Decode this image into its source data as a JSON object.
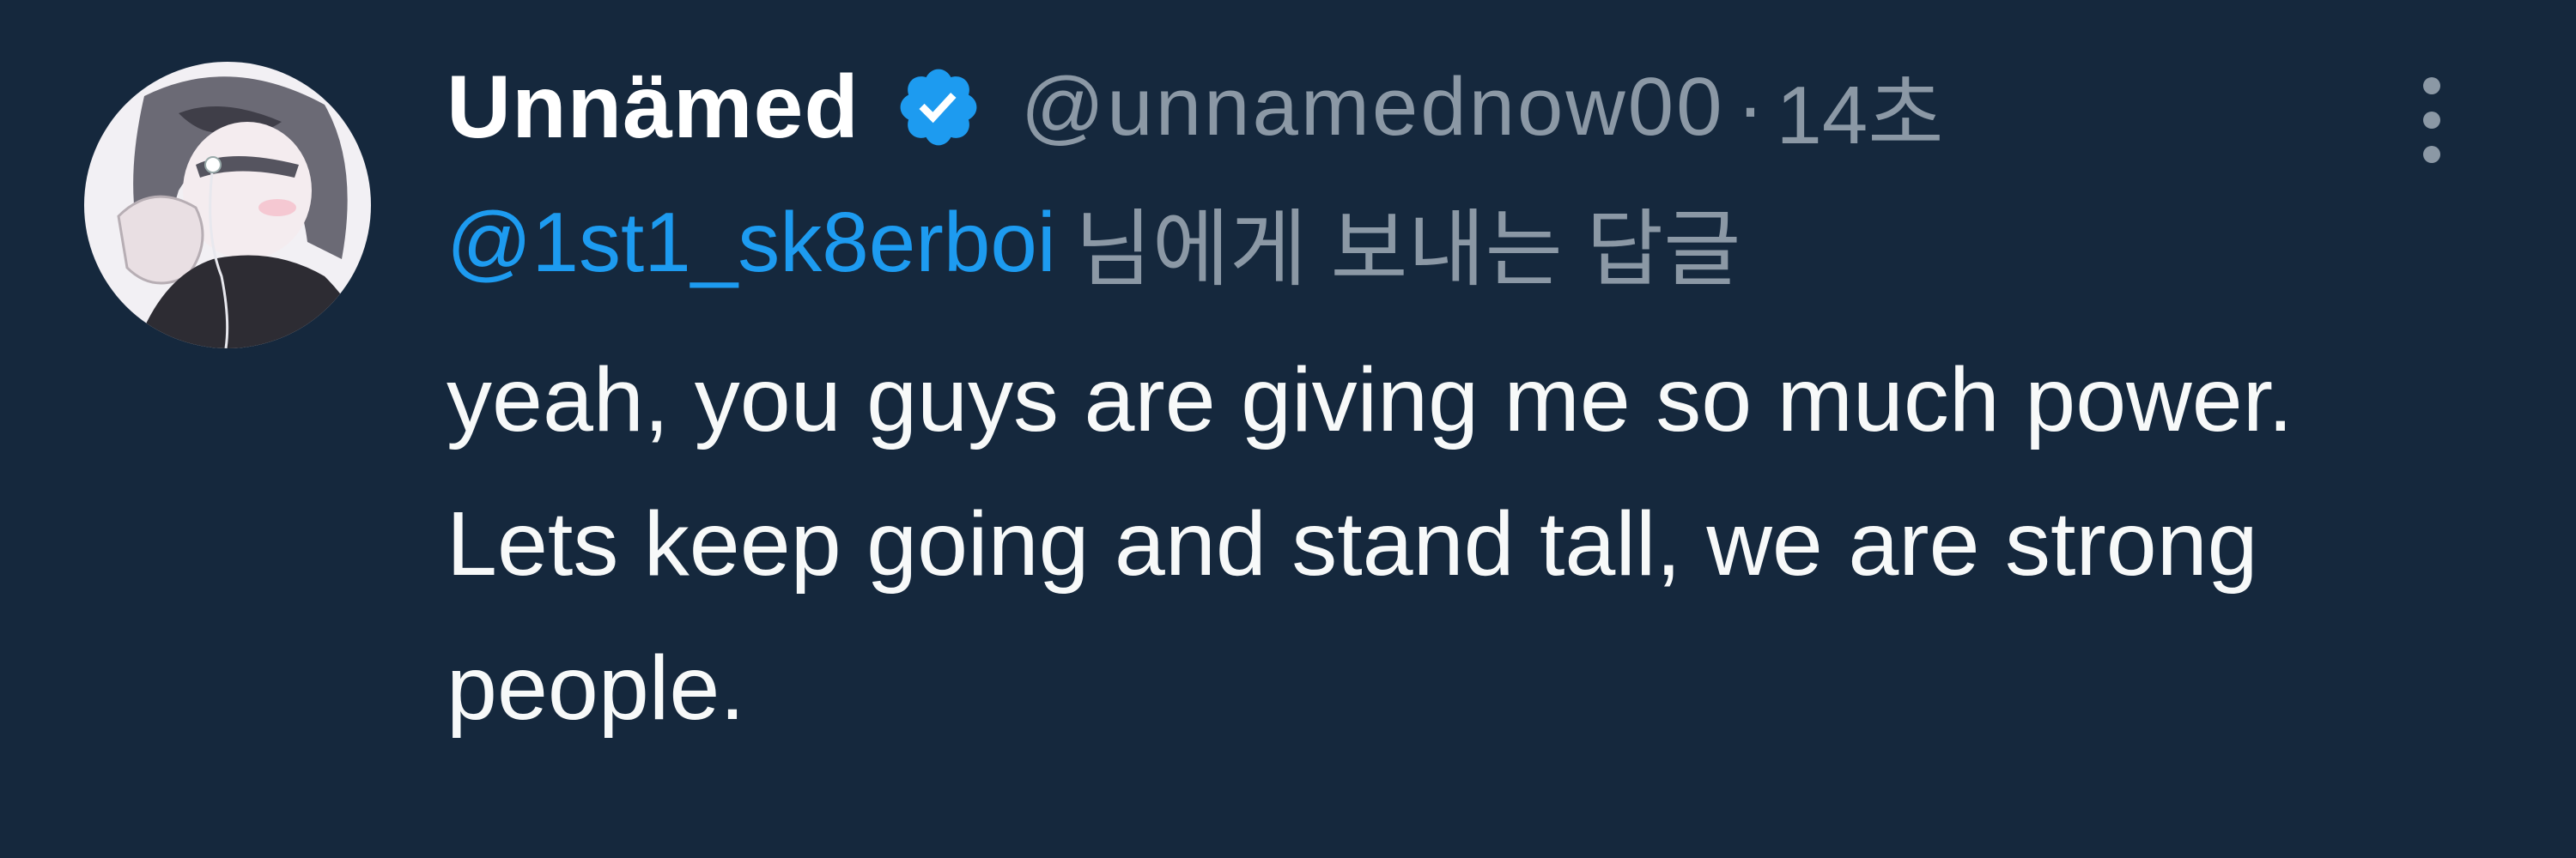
{
  "tweet": {
    "display_name": "Unnämed",
    "handle": "@unnamednow00",
    "separator": "·",
    "time": "14초",
    "reply_to_handle": "@1st1_sk8erboi",
    "reply_suffix": "님에게 보내는 답글",
    "text": "yeah, you guys are giving me so much power. Lets keep going and stand tall, we are strong people."
  },
  "icons": {
    "verified": "verified-badge-icon",
    "more": "more-vertical-icon",
    "avatar": "avatar-image"
  },
  "colors": {
    "background": "#15283d",
    "primary_text": "#ffffff",
    "secondary_text": "#8b98a5",
    "accent": "#1d9bf0"
  }
}
